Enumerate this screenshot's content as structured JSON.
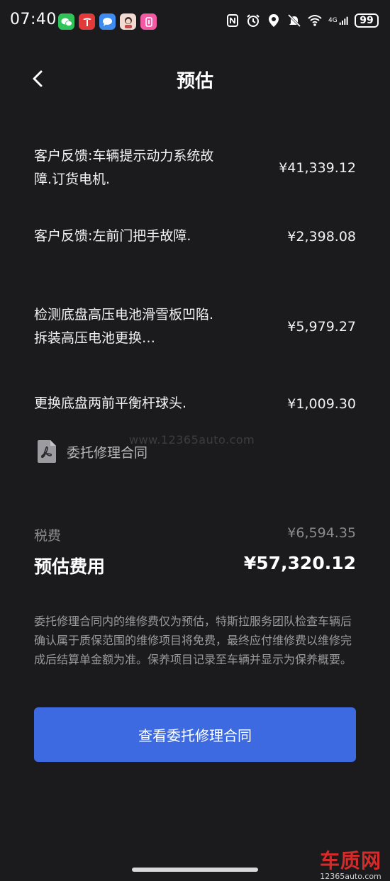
{
  "status_bar": {
    "time": "07:40",
    "battery": "99",
    "network": "4G"
  },
  "header": {
    "title": "预估"
  },
  "items": [
    {
      "description": "客户反馈:车辆提示动力系统故障.订货电机.",
      "price": "¥41,339.12"
    },
    {
      "description": "客户反馈:左前门把手故障.",
      "price": "¥2,398.08"
    },
    {
      "description": "检测底盘高压电池滑雪板凹陷.拆装高压电池更换…",
      "price": "¥5,979.27"
    },
    {
      "description": "更换底盘两前平衡杆球头.",
      "price": "¥1,009.30"
    }
  ],
  "contract_link": {
    "label": "委托修理合同"
  },
  "watermark": "www.12365auto.com",
  "summary": {
    "tax_label": "税费",
    "tax_value": "¥6,594.35",
    "total_label": "预估费用",
    "total_value": "¥57,320.12"
  },
  "disclaimer": "委托修理合同内的维修费仅为预估，特斯拉服务团队检查车辆后确认属于质保范围的维修项目将免费，最终应付维修费以维修完成后结算单金额为准。保养项目记录至车辆并显示为保养概要。",
  "actions": {
    "view_contract": "查看委托修理合同"
  },
  "branding": {
    "logo_text": "车质网",
    "logo_url": "12365auto.com"
  },
  "colors": {
    "background": "#1b1b1d",
    "primary_button": "#3e6ae1",
    "logo_red": "#d42b2b"
  }
}
